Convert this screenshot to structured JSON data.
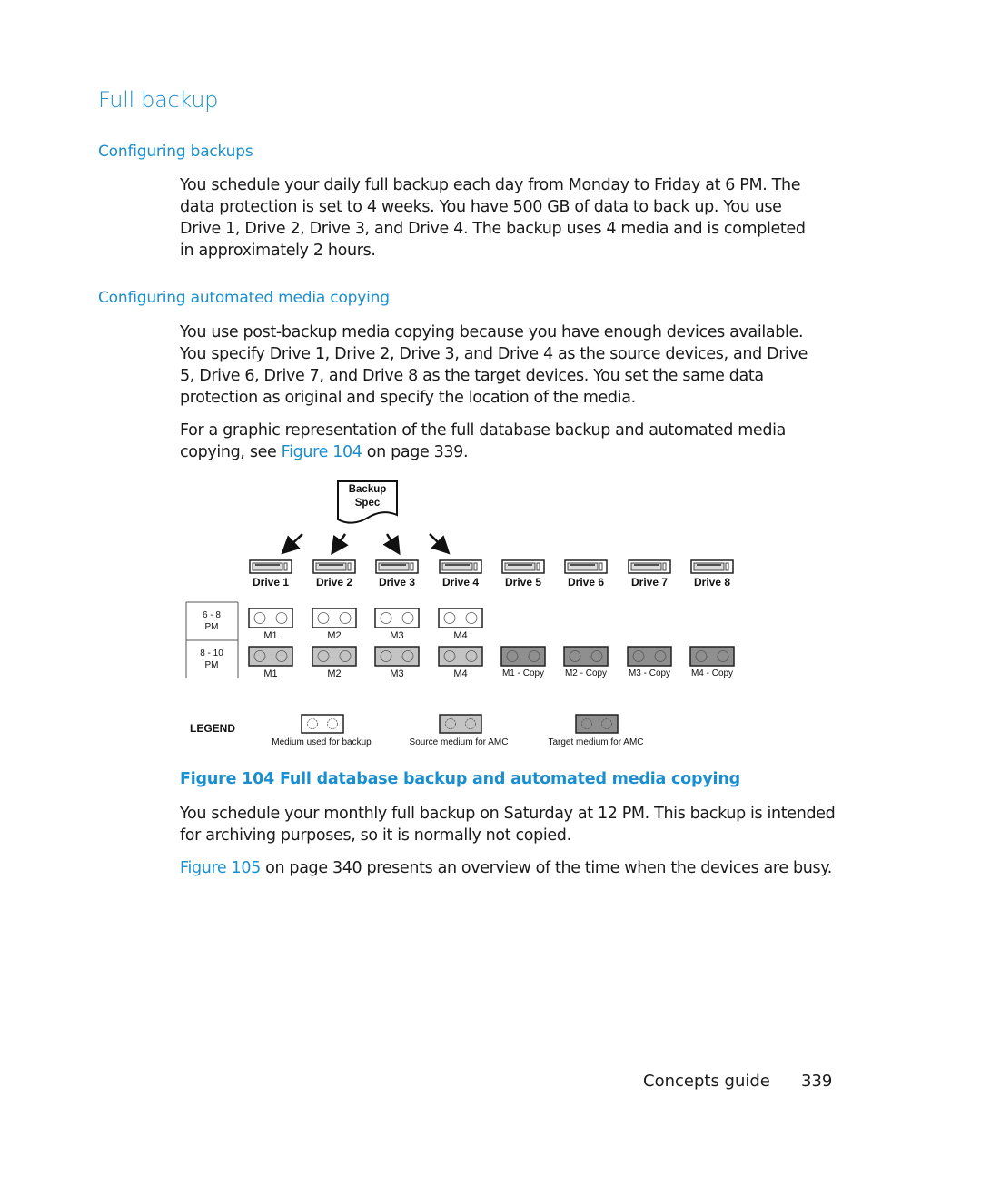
{
  "section_title": "Full backup",
  "sub1": {
    "heading": "Configuring backups",
    "lines": [
      "You schedule your daily full backup each day from Monday to Friday at 6 PM. The",
      "data protection is set to 4 weeks. You have 500 GB of data to back up. You use",
      "Drive 1, Drive 2, Drive 3, and Drive 4. The backup uses 4 media and is completed",
      "in approximately 2 hours."
    ]
  },
  "sub2": {
    "heading": "Configuring automated media copying",
    "lines": [
      "You use post-backup media copying because you have enough devices available.",
      "You specify Drive 1, Drive 2, Drive 3, and Drive 4 as the source devices, and Drive",
      "5, Drive 6, Drive 7, and Drive 8 as the target devices. You set the same data",
      "protection as original and specify the location of the media."
    ],
    "ref_line1": "For a graphic representation of the full database backup and automated media",
    "ref_pre": "copying, see ",
    "ref_link": "Figure 104",
    "ref_post": " on page 339."
  },
  "figure": {
    "spec_line1": "Backup",
    "spec_line2": "Spec",
    "drives": [
      "Drive 1",
      "Drive 2",
      "Drive 3",
      "Drive 4",
      "Drive 5",
      "Drive 6",
      "Drive 7",
      "Drive 8"
    ],
    "time_slots": [
      {
        "line1": "6 - 8",
        "line2": "PM",
        "media": [
          "M1",
          "M2",
          "M3",
          "M4"
        ]
      },
      {
        "line1": "8 - 10",
        "line2": "PM",
        "media": [
          "M1",
          "M2",
          "M3",
          "M4",
          "M1 - Copy",
          "M2 - Copy",
          "M3 - Copy",
          "M4 - Copy"
        ]
      }
    ],
    "legend": {
      "title": "LEGEND",
      "items": [
        {
          "label": "Medium used for backup",
          "color": "#ffffff"
        },
        {
          "label": "Source medium for AMC",
          "color": "#c4c4c4"
        },
        {
          "label": "Target medium for AMC",
          "color": "#8f8f8f"
        }
      ]
    },
    "caption": "Figure 104 Full database backup and automated media copying"
  },
  "after": {
    "lines": [
      "You schedule your monthly full backup on Saturday at 12 PM. This backup is intended",
      "for archiving purposes, so it is normally not copied."
    ],
    "ref_link": "Figure 105",
    "ref_post": " on page 340 presents an overview of the time when the devices are busy."
  },
  "footer": {
    "title": "Concepts guide",
    "page": "339"
  }
}
